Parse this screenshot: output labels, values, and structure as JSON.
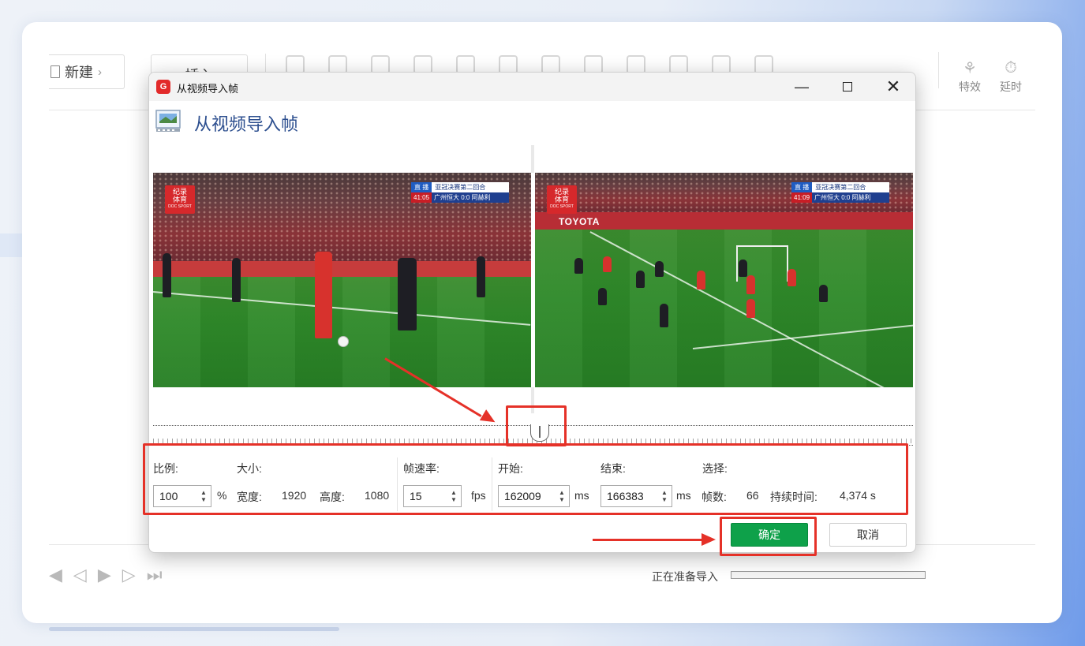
{
  "toolbar": {
    "new_label": "新建",
    "insert_label": "插入",
    "effects_label": "特效",
    "delay_label": "延时"
  },
  "dialog": {
    "window_title": "从视频导入帧",
    "header_title": "从视频导入帧",
    "preview": {
      "left_frame": {
        "channel_logo": "纪录\n体育",
        "channel_sub": "DOC SPORT",
        "live_tag": "直 播",
        "match_title": "亚冠决赛第二回合",
        "clock": "41:05",
        "score_text": "广州恒大 0:0 阿赫利"
      },
      "right_frame": {
        "channel_logo": "纪录\n体育",
        "channel_sub": "DOC SPORT",
        "live_tag": "直 播",
        "match_title": "亚冠决赛第二回合",
        "clock": "41:09",
        "score_text": "广州恒大 0:0 阿赫利",
        "ad_text": "TOYOTA"
      }
    },
    "params": {
      "ratio_label": "比例:",
      "ratio_value": "100",
      "ratio_unit": "%",
      "size_label": "大小:",
      "width_label": "宽度:",
      "width_value": "1920",
      "height_label": "高度:",
      "height_value": "1080",
      "fps_label": "帧速率:",
      "fps_value": "15",
      "fps_unit": "fps",
      "start_label": "开始:",
      "start_value": "162009",
      "start_unit": "ms",
      "end_label": "结束:",
      "end_value": "166383",
      "end_unit": "ms",
      "selection_label": "选择:",
      "frames_label": "帧数:",
      "frames_value": "66",
      "duration_label": "持续时间:",
      "duration_value": "4,374 s"
    },
    "ok_label": "确定",
    "cancel_label": "取消"
  },
  "status": {
    "preparing_label": "正在准备导入"
  },
  "colors": {
    "accent_green": "#0ea14a",
    "annotation_red": "#e53128",
    "header_blue": "#2d4f8f"
  }
}
